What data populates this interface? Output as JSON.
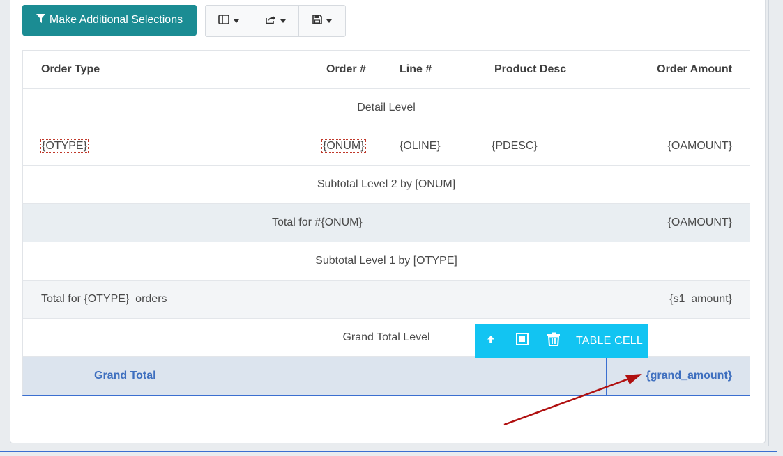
{
  "toolbar": {
    "filter_button_label": "Make Additional Selections",
    "group_buttons": [
      {
        "icon": "columns-icon"
      },
      {
        "icon": "share-icon"
      },
      {
        "icon": "save-icon"
      }
    ]
  },
  "table": {
    "headers": {
      "order_type": "Order Type",
      "order_num": "Order #",
      "line_num": "Line #",
      "product_desc": "Product Desc",
      "order_amount": "Order Amount"
    },
    "detail_level_label": "Detail Level",
    "detail_row": {
      "order_type": "{OTYPE}",
      "order_num": "{ONUM}",
      "line_num": "{OLINE}",
      "product_desc": "{PDESC}",
      "order_amount": "{OAMOUNT}"
    },
    "subtotal2_label": "Subtotal Level 2 by [ONUM]",
    "total_onum_row": {
      "label": "Total for #{ONUM}",
      "amount": "{OAMOUNT}"
    },
    "subtotal1_label": "Subtotal Level 1 by [OTYPE]",
    "total_otype_row": {
      "label": "Total for {OTYPE}  orders",
      "amount": "{s1_amount}"
    },
    "grand_total_level_label": "Grand Total Level",
    "grand_total_row": {
      "label": "Grand Total",
      "amount": "{grand_amount}"
    }
  },
  "floating_toolbar": {
    "label": "TABLE CELL",
    "icons": [
      "arrow-up-icon",
      "select-cell-icon",
      "trash-icon"
    ]
  },
  "colors": {
    "primary_button": "#1b8c93",
    "floating_toolbar": "#12c4f2",
    "grand_total_text": "#3e6fbf",
    "annotation_arrow": "#b01010"
  }
}
